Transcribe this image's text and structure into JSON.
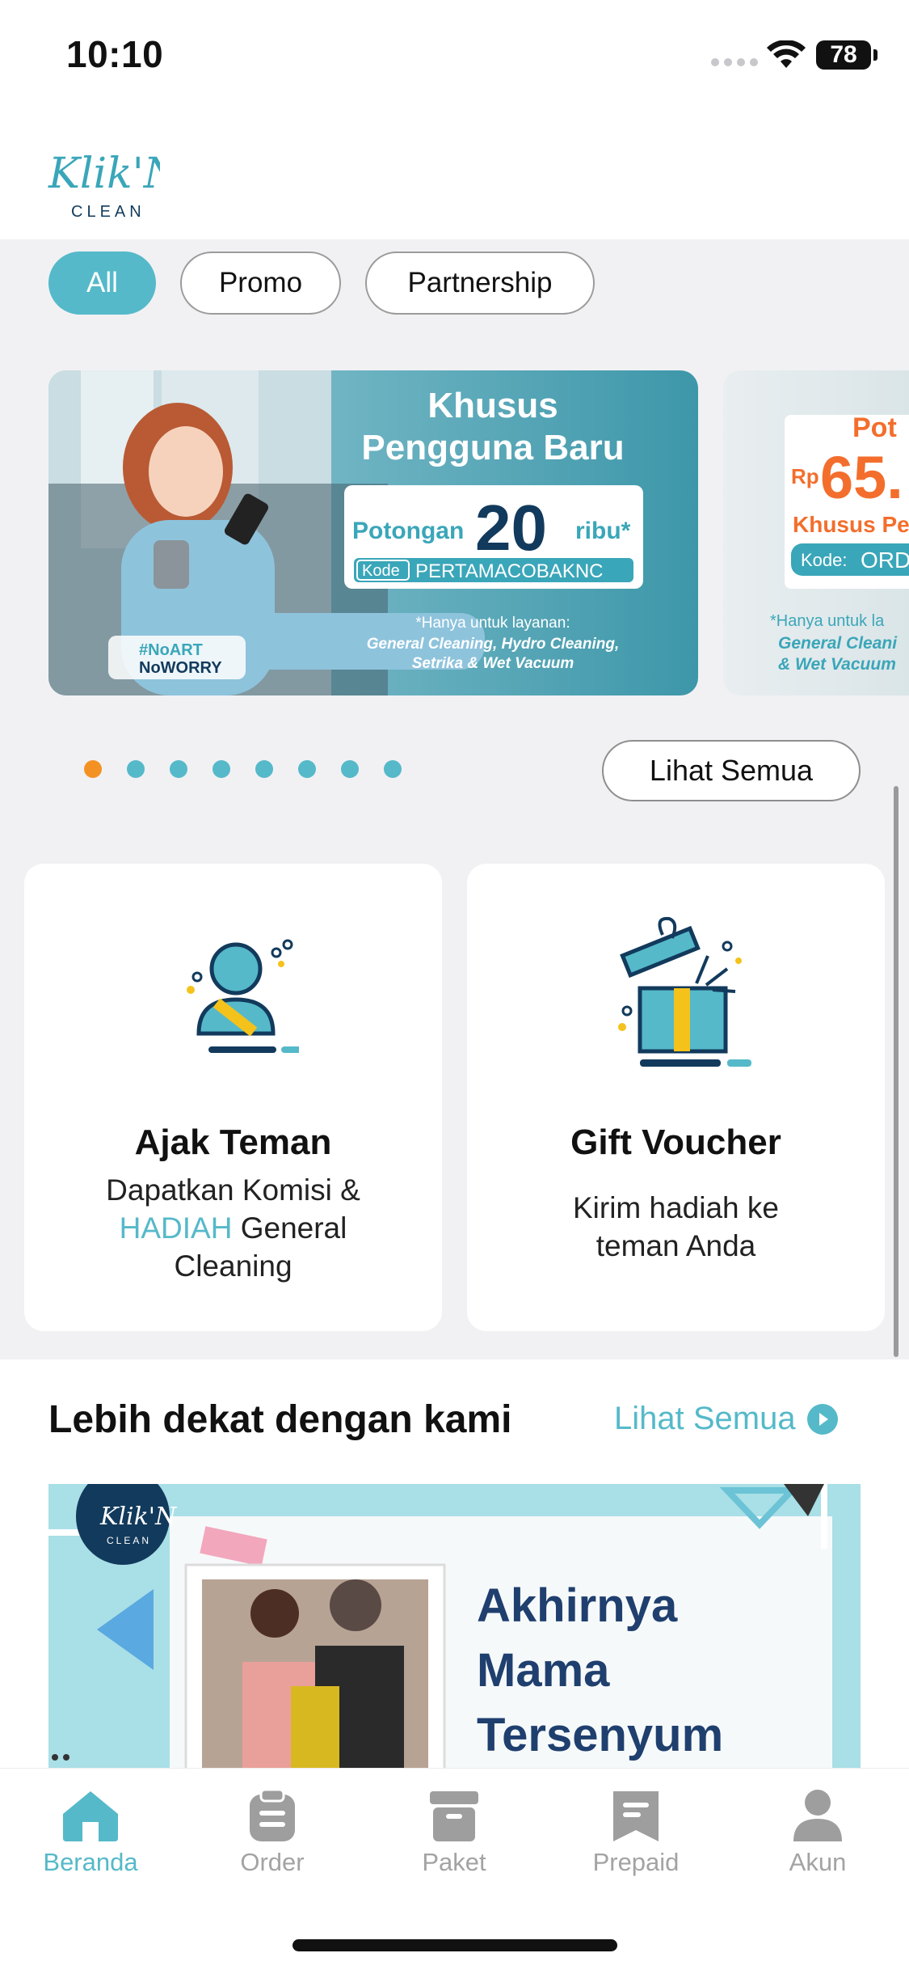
{
  "status_bar": {
    "time": "10:10",
    "battery": "78"
  },
  "logo": {
    "text_top": "Klik'N",
    "text_bottom": "CLEAN"
  },
  "filter_chips": [
    {
      "label": "All",
      "active": true
    },
    {
      "label": "Promo",
      "active": false
    },
    {
      "label": "Partnership",
      "active": false
    }
  ],
  "banners": [
    {
      "headline_1": "Khusus",
      "headline_2": "Pengguna Baru",
      "discount_prefix": "Potongan",
      "discount_value": "20",
      "discount_suffix": "ribu*",
      "code_label": "Kode",
      "code": "PERTAMACOBAKNC",
      "note_1": "*Hanya untuk layanan:",
      "note_2": "General Cleaning, Hydro Cleaning,",
      "note_3": "Setrika & Wet Vacuum",
      "badge_1": "#NoART",
      "badge_2": "NoWORRY"
    },
    {
      "headline": "Pot",
      "currency": "Rp",
      "discount_value": "65.",
      "sub": "Khusus Pe",
      "code_label": "Kode:",
      "code": "ORD",
      "note_1": "*Hanya untuk la",
      "note_2": "General Cleani",
      "note_3": "& Wet Vacuum"
    }
  ],
  "carousel": {
    "dot_count": 8,
    "active_index": 0
  },
  "see_all_button": "Lihat Semua",
  "cards": [
    {
      "title": "Ajak Teman",
      "desc_1": "Dapatkan Komisi &",
      "desc_highlight": "HADIAH",
      "desc_2": "General",
      "desc_3": "Cleaning"
    },
    {
      "title": "Gift Voucher",
      "desc_1": "Kirim hadiah ke",
      "desc_2": "teman Anda"
    }
  ],
  "section": {
    "title": "Lebih dekat dengan kami",
    "link": "Lihat Semua"
  },
  "article": {
    "logo_top": "Klik'N",
    "logo_bottom": "CLEAN",
    "line_1": "Akhirnya",
    "line_2": "Mama",
    "line_3": "Tersenyum"
  },
  "tabs": [
    {
      "label": "Beranda",
      "icon": "home-icon",
      "active": true
    },
    {
      "label": "Order",
      "icon": "clipboard-icon",
      "active": false
    },
    {
      "label": "Paket",
      "icon": "box-icon",
      "active": false
    },
    {
      "label": "Prepaid",
      "icon": "bookmark-icon",
      "active": false
    },
    {
      "label": "Akun",
      "icon": "person-icon",
      "active": false
    }
  ],
  "colors": {
    "accent": "#55b9c9",
    "active_dot": "#f39223",
    "dark_navy": "#123a5c"
  }
}
